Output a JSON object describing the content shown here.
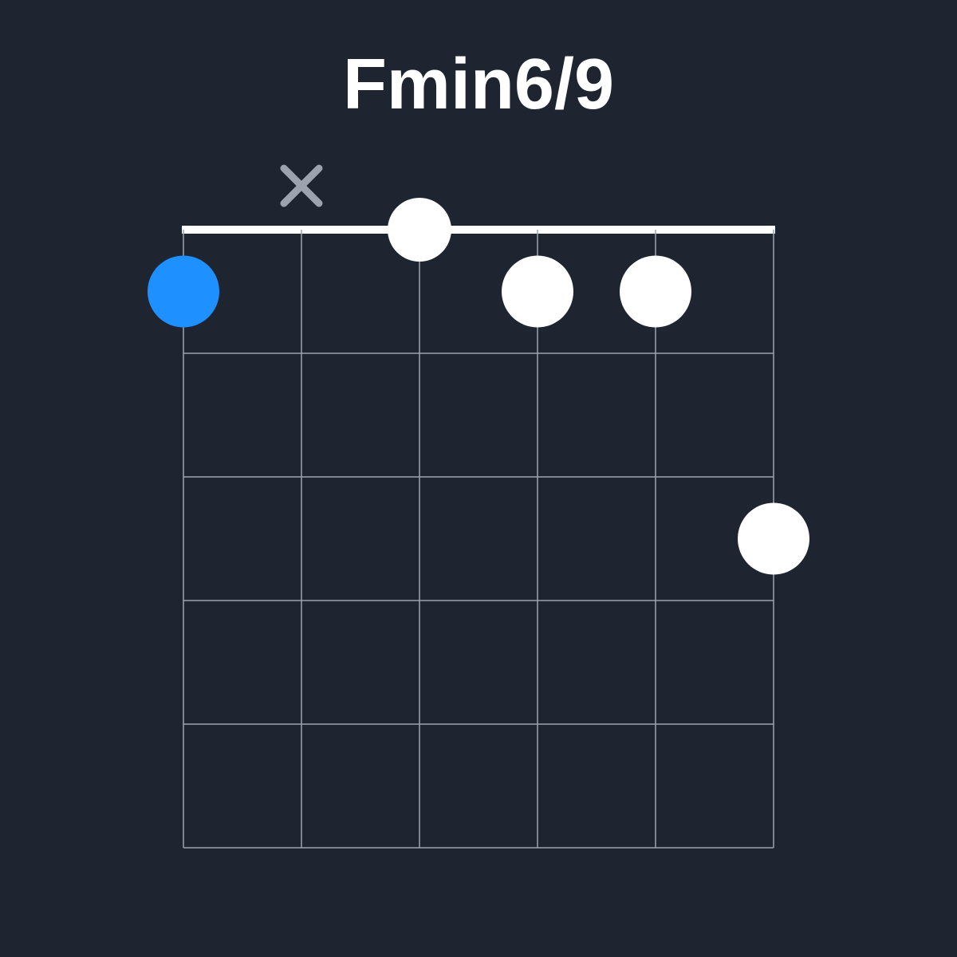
{
  "chord": {
    "name": "Fmin6/9"
  },
  "chart_data": {
    "type": "chord-diagram",
    "num_strings": 6,
    "num_frets": 5,
    "strings": [
      {
        "string": 1,
        "state": "fretted",
        "fret": 1,
        "is_root": true
      },
      {
        "string": 2,
        "state": "muted"
      },
      {
        "string": 3,
        "state": "open"
      },
      {
        "string": 4,
        "state": "fretted",
        "fret": 1,
        "is_root": false
      },
      {
        "string": 5,
        "state": "fretted",
        "fret": 1,
        "is_root": false
      },
      {
        "string": 6,
        "state": "fretted",
        "fret": 3,
        "is_root": false
      }
    ],
    "colors": {
      "background": "#1e2430",
      "grid": "#9ca3af",
      "nut": "#ffffff",
      "dot": "#ffffff",
      "root": "#1e90ff",
      "mute": "#9ca3af"
    }
  }
}
